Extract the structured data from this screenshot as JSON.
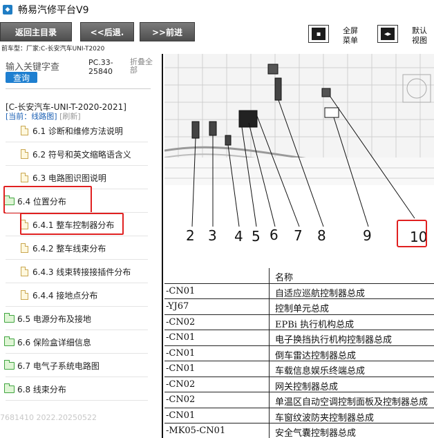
{
  "window": {
    "title": "畅易汽修平台V9",
    "icon": "app-logo-icon"
  },
  "toolbar": {
    "back_main": "返回主目录",
    "back": "<<后退.",
    "forward": ">>前进",
    "fullscreen_label": "全屏",
    "menu_label": "菜单",
    "default_label": "默认",
    "view_label": "视图"
  },
  "vehicle_line": "前车型：厂家:C-长安汽车UNI-T2020",
  "search": {
    "placeholder": "输入关键字查",
    "button": "查询",
    "pc_code_1": "PC.33-",
    "pc_code_2": "25840",
    "fold_1": "折叠全",
    "fold_2": "部"
  },
  "tree": {
    "car_title": "[C-长安汽车-UNI-T-2020-2021]",
    "current_prefix": "[当前：线路图]",
    "refresh": "[刷新]",
    "items": [
      {
        "label": "6.1 诊断和维修方法说明",
        "type": "doc"
      },
      {
        "label": "6.2 符号和英文缩略语含义",
        "type": "doc"
      },
      {
        "label": "6.3 电路图识图说明",
        "type": "doc"
      },
      {
        "label": "6.4 位置分布",
        "type": "folder-open"
      },
      {
        "label": "6.4.1 整车控制器分布",
        "type": "doc"
      },
      {
        "label": "6.4.2 整车线束分布",
        "type": "doc"
      },
      {
        "label": "6.4.3 线束转接接插件分布",
        "type": "doc"
      },
      {
        "label": "6.4.4 接地点分布",
        "type": "doc"
      },
      {
        "label": "6.5 电源分布及接地",
        "type": "folder"
      },
      {
        "label": "6.6 保险盒详细信息",
        "type": "folder"
      },
      {
        "label": "6.7 电气子系统电路图",
        "type": "folder"
      },
      {
        "label": "6.8 线束分布",
        "type": "folder"
      }
    ]
  },
  "watermark": "7681410 2022.20250522",
  "diagram": {
    "labels": [
      "2",
      "3",
      "4",
      "5",
      "6",
      "7",
      "8",
      "9",
      "10"
    ]
  },
  "table": {
    "header": {
      "code": "",
      "name": "名称"
    },
    "rows": [
      {
        "code": "-CN01",
        "name": "自适应巡航控制器总成"
      },
      {
        "code": "-YJ67",
        "name": "控制单元总成"
      },
      {
        "code": "-CN02",
        "name": "EPBi 执行机构总成"
      },
      {
        "code": "-CN01",
        "name": "电子换挡执行机构控制器总成"
      },
      {
        "code": "-CN01",
        "name": "倒车雷达控制器总成"
      },
      {
        "code": "-CN01",
        "name": "车载信息娱乐终端总成"
      },
      {
        "code": "-CN02",
        "name": "网关控制器总成"
      },
      {
        "code": "-CN02",
        "name": "单温区自动空调控制面板及控制器总成"
      },
      {
        "code": "-CN01",
        "name": "车窗纹波防夹控制器总成"
      },
      {
        "code": "-MK05-CN01",
        "name": "安全气囊控制器总成"
      }
    ]
  },
  "colors": {
    "highlight": "#e02020",
    "link": "#1a5fb4",
    "button": "#1e7fd0"
  }
}
